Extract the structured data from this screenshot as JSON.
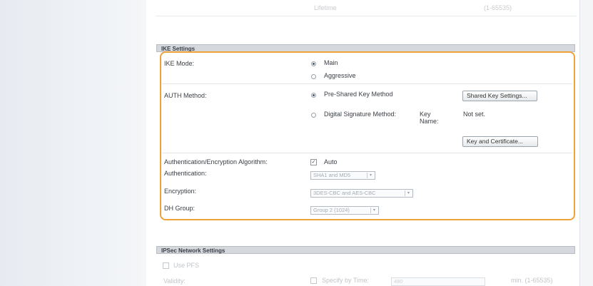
{
  "top_faint": {
    "text1": "Lifetime",
    "text2": "(1-65535)"
  },
  "ike": {
    "header": "IKE Settings",
    "mode_label": "IKE Mode:",
    "mode_options": [
      "Main",
      "Aggressive"
    ],
    "mode_selected": "Main",
    "auth_label": "AUTH Method:",
    "auth_psk": "Pre-Shared Key Method",
    "shared_key_button": "Shared Key Settings...",
    "auth_ds": "Digital Signature Method:",
    "key_name_label_line1": "Key",
    "key_name_label_line2": "Name:",
    "key_name_value": "Not set.",
    "key_cert_button": "Key and Certificate...",
    "algo_label": "Authentication/Encryption Algorithm:",
    "auto_label": "Auto",
    "auto_checked": "✓",
    "authentication_label": "Authentication:",
    "authentication_value": "SHA1 and MD5",
    "encryption_label": "Encryption:",
    "encryption_value": "3DES-CBC and AES-CBC",
    "dh_label": "DH Group:",
    "dh_value": "Group 2 (1024)",
    "dropdown_arrow": "▾"
  },
  "ipsec": {
    "header": "IPSec Network Settings",
    "use_pfs": "Use PFS",
    "validity_label": "Validity:",
    "specify_by_time": "Specify by Time:",
    "time_value": "480",
    "time_range": "min. (1-65535)"
  },
  "colors": {
    "highlight": "#f0a23a",
    "header_bg": "#d5d9de"
  }
}
